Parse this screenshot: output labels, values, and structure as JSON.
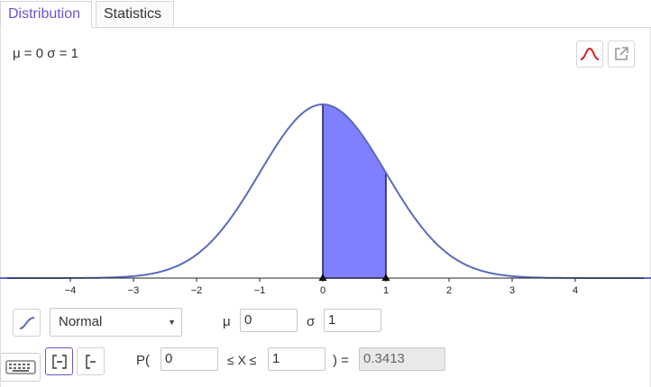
{
  "tabs": [
    {
      "label": "Distribution",
      "active": true
    },
    {
      "label": "Statistics",
      "active": false
    }
  ],
  "params_label": "μ = 0 σ = 1",
  "toolbar_icons": [
    "normal-curve-icon",
    "export-icon"
  ],
  "colors": {
    "accent": "#6557d2",
    "curve": "#5a6abf",
    "fill": "#8080ff",
    "curve_icon": "#e02020"
  },
  "chart_data": {
    "type": "area",
    "title": "",
    "xlabel": "",
    "ylabel": "",
    "xlim": [
      -5,
      5
    ],
    "ylim": [
      0,
      0.4
    ],
    "x_ticks": [
      -4,
      -3,
      -2,
      -1,
      0,
      1,
      2,
      3,
      4
    ],
    "x_tick_labels": [
      "−4",
      "−3",
      "−2",
      "−1",
      "0",
      "1",
      "2",
      "3",
      "4"
    ],
    "mu": 0,
    "sigma": 1,
    "shaded_interval": [
      0,
      1
    ],
    "grid": false
  },
  "controls": {
    "distribution": "Normal",
    "mu_label": "μ",
    "mu_value": "0",
    "sigma_label": "σ",
    "sigma_value": "1",
    "p_open": "P(",
    "lower_value": "0",
    "between": "≤ X ≤",
    "upper_value": "1",
    "p_close": ") =",
    "result": "0.3413"
  }
}
